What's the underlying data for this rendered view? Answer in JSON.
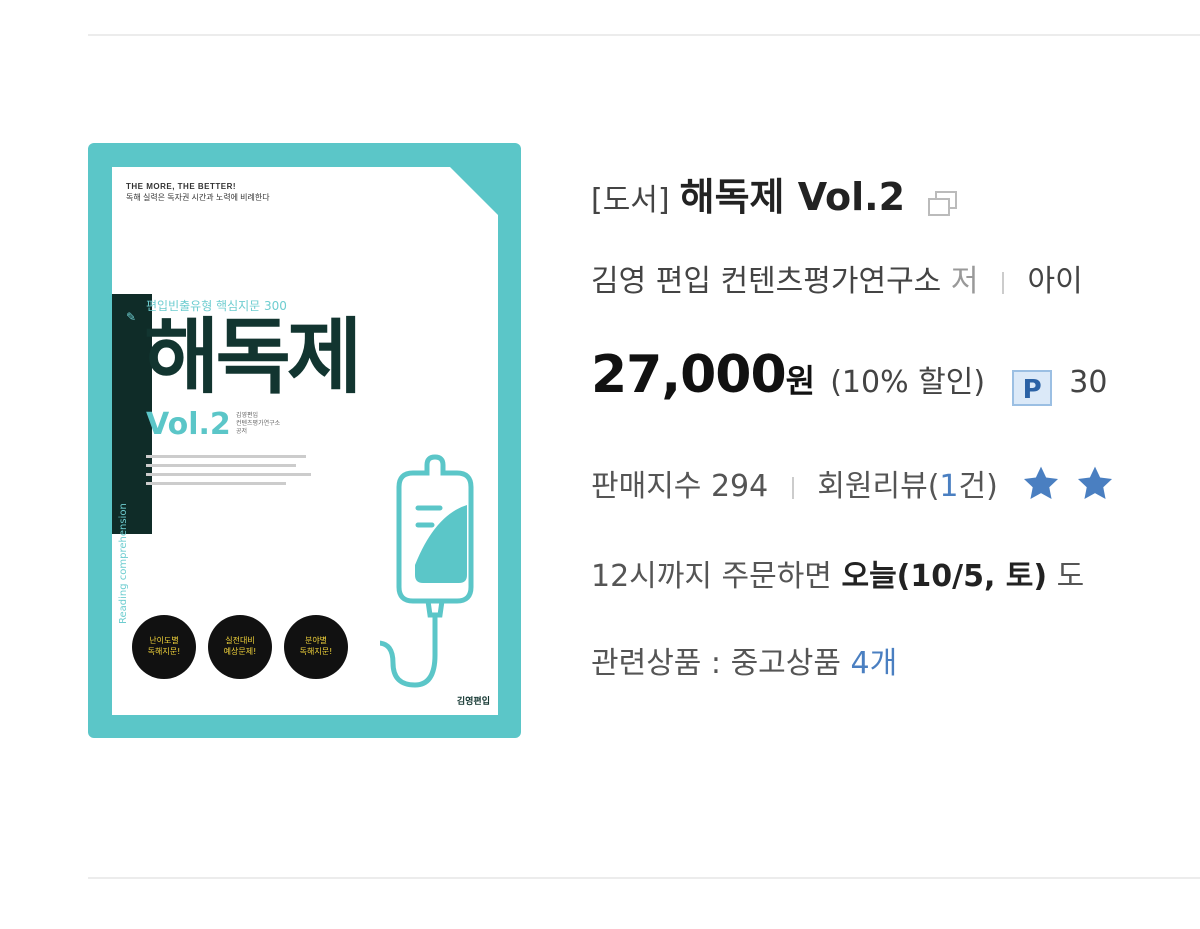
{
  "product": {
    "category": "[도서]",
    "title": "해독제 Vol.2",
    "author": "김영 편입 컨텐츠평가연구소",
    "author_role": "저",
    "publisher_partial": "아이",
    "price": "27,000",
    "currency": "원",
    "discount": "(10% 할인)",
    "point_badge": "P",
    "points_partial": "30",
    "sales_label": "판매지수",
    "sales_index": "294",
    "review_label": "회원리뷰(",
    "review_count": "1",
    "review_suffix": "건)",
    "rating_stars": 2,
    "delivery_prefix": "12시까지 주문하면",
    "delivery_bold": "오늘(10/5, 토)",
    "delivery_suffix": "도",
    "related_label": "관련상품 : 중고상품",
    "related_count": "4개"
  },
  "cover": {
    "slogan_line1": "THE MORE, THE BETTER!",
    "slogan_line2": "독해 실력은 독자권 시간과 노력에 비례한다",
    "subtitle": "편입빈출유형 핵심지문 300",
    "title": "해독제",
    "volume": "Vol.2",
    "authors_line1": "김영편입",
    "authors_line2": "컨텐츠평가연구소",
    "authors_line3": "공저",
    "spine_text": "Reading comprehension",
    "badge1_line1": "난이도별",
    "badge1_line2": "독해지문!",
    "badge2_line1": "실전대비",
    "badge2_line2": "예상문제!",
    "badge3_line1": "분야별",
    "badge3_line2": "독해지문!",
    "publisher": "김영편입"
  },
  "colors": {
    "cover_teal": "#5bc6c8",
    "link_blue": "#4a7fc1",
    "star_blue": "#4a7fc1"
  }
}
